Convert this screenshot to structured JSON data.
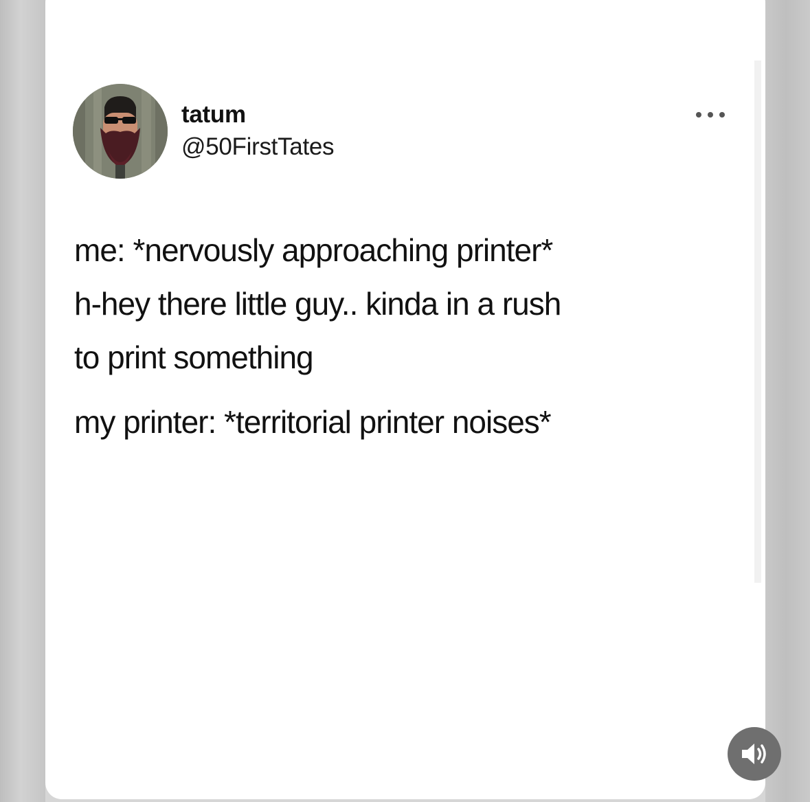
{
  "tweet": {
    "display_name": "tatum",
    "handle": "@50FirstTates",
    "more_icon": "more-horizontal-icon",
    "lines": [
      "me: *nervously approaching printer*",
      "h-hey there little guy.. kinda in a rush",
      "to print something"
    ],
    "reply_line": "my printer: *territorial printer noises*"
  },
  "controls": {
    "volume_icon": "speaker-volume-icon"
  },
  "colors": {
    "card_background": "#ffffff",
    "page_background": "#cccccc",
    "text": "#111111",
    "volume_button": "#6f6f6f"
  }
}
